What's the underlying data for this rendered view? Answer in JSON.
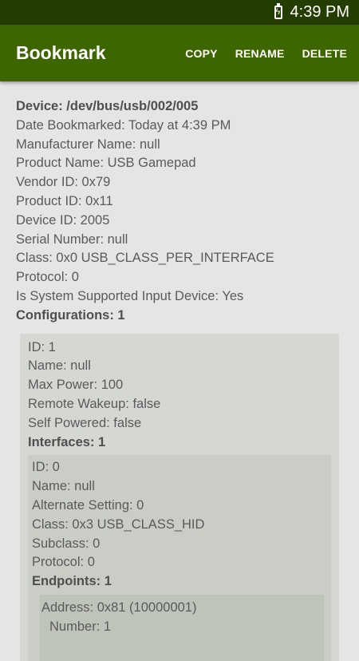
{
  "status": {
    "time": "4:39 PM"
  },
  "appbar": {
    "title": "Bookmark",
    "copy": "COPY",
    "rename": "RENAME",
    "delete": "DELETE"
  },
  "device": {
    "path": "Device: /dev/bus/usb/002/005",
    "date": "Date Bookmarked: Today at 4:39 PM",
    "manufacturer": "Manufacturer Name: null",
    "product_name": "Product Name: USB Gamepad",
    "vendor_id": "Vendor ID: 0x79",
    "product_id": "Product ID: 0x11",
    "device_id": "Device ID: 2005",
    "serial": "Serial Number: null",
    "class": "Class: 0x0 USB_CLASS_PER_INTERFACE",
    "protocol": "Protocol: 0",
    "input_supported": "Is System Supported Input Device: Yes",
    "configurations": "Configurations: 1"
  },
  "configuration": {
    "id": "ID: 1",
    "name": "Name: null",
    "max_power": "Max Power: 100",
    "remote_wakeup": "Remote Wakeup: false",
    "self_powered": "Self Powered: false",
    "interfaces": "Interfaces: 1"
  },
  "interface": {
    "id": "ID: 0",
    "name": "Name: null",
    "alt_setting": "Alternate Setting: 0",
    "class": "Class: 0x3 USB_CLASS_HID",
    "subclass": "Subclass: 0",
    "protocol": "Protocol: 0",
    "endpoints": "Endpoints: 1"
  },
  "endpoint": {
    "address": "Address: 0x81 (10000001)",
    "number": "Number: 1"
  }
}
